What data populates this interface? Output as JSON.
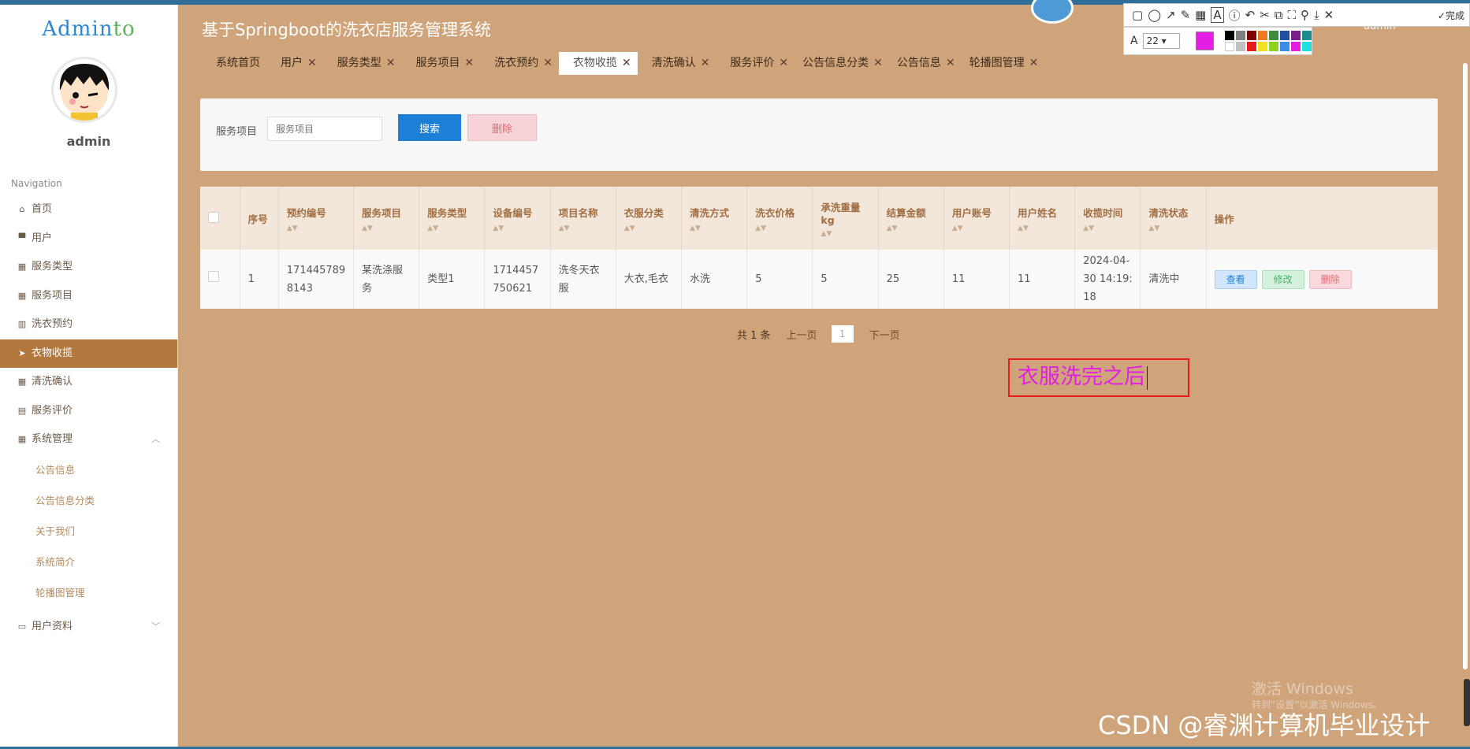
{
  "app": {
    "logo_main": "Admin",
    "logo_accent": "to",
    "username": "admin",
    "title": "基于Springboot的洗衣店服务管理系统",
    "top_user": "admin"
  },
  "sidebar": {
    "nav_label": "Navigation",
    "items": [
      {
        "label": "首页",
        "icon": "home-icon",
        "glyph": "⌂"
      },
      {
        "label": "用户",
        "icon": "monitor-icon",
        "glyph": "▀"
      },
      {
        "label": "服务类型",
        "icon": "grid-icon",
        "glyph": "▦"
      },
      {
        "label": "服务项目",
        "icon": "grid-icon",
        "glyph": "▦"
      },
      {
        "label": "洗衣预约",
        "icon": "book-icon",
        "glyph": "▥"
      },
      {
        "label": "衣物收揽",
        "icon": "send-icon",
        "glyph": "➤"
      },
      {
        "label": "清洗确认",
        "icon": "grid-icon",
        "glyph": "▦"
      },
      {
        "label": "服务评价",
        "icon": "clipboard-icon",
        "glyph": "▤"
      },
      {
        "label": "系统管理",
        "icon": "grid-icon",
        "glyph": "▦"
      }
    ],
    "sub_items": [
      "公告信息",
      "公告信息分类",
      "关于我们",
      "系统简介",
      "轮播图管理"
    ],
    "bottom_item": {
      "label": "用户资料",
      "icon": "card-icon",
      "glyph": "▭"
    }
  },
  "tabs": [
    {
      "label": "系统首页",
      "closable": false
    },
    {
      "label": "用户",
      "closable": true
    },
    {
      "label": "服务类型",
      "closable": true
    },
    {
      "label": "服务项目",
      "closable": true
    },
    {
      "label": "洗衣预约",
      "closable": true
    },
    {
      "label": "衣物收揽",
      "closable": true,
      "active": true
    },
    {
      "label": "清洗确认",
      "closable": true
    },
    {
      "label": "服务评价",
      "closable": true
    },
    {
      "label": "公告信息分类",
      "closable": true
    },
    {
      "label": "公告信息",
      "closable": true
    },
    {
      "label": "轮播图管理",
      "closable": true
    }
  ],
  "search": {
    "label": "服务项目",
    "placeholder": "服务项目",
    "search_btn": "搜索",
    "delete_btn": "删除"
  },
  "table": {
    "headers": [
      "序号",
      "预约编号",
      "服务项目",
      "服务类型",
      "设备编号",
      "项目名称",
      "衣服分类",
      "清洗方式",
      "洗衣价格",
      "承洗重量kg",
      "结算金额",
      "用户账号",
      "用户姓名",
      "收揽时间",
      "清洗状态",
      "操作"
    ],
    "rows": [
      {
        "cells": [
          "1",
          "1714457898143",
          "某洗涤服务",
          "类型1",
          "1714457750621",
          "洗冬天衣服",
          "大衣,毛衣",
          "水洗",
          "5",
          "5",
          "25",
          "11",
          "11",
          "2024-04-30 14:19:18",
          "清洗中"
        ],
        "actions": [
          "查看",
          "修改",
          "删除"
        ]
      }
    ]
  },
  "pager": {
    "total": "共 1 条",
    "prev": "上一页",
    "page": "1",
    "next": "下一页"
  },
  "annotation": {
    "text": "衣服洗完之后",
    "color": "#e21fe2"
  },
  "screenshot_tool": {
    "font_size": "22",
    "done": "完成"
  },
  "watermarks": {
    "windows_title": "激活 Windows",
    "windows_sub": "转到“设置”以激活 Windows。",
    "csdn": "CSDN @睿渊计算机毕业设计"
  },
  "colors": {
    "accent": "#b2783e",
    "background": "#cfa47b",
    "primary": "#1e7fd6"
  }
}
